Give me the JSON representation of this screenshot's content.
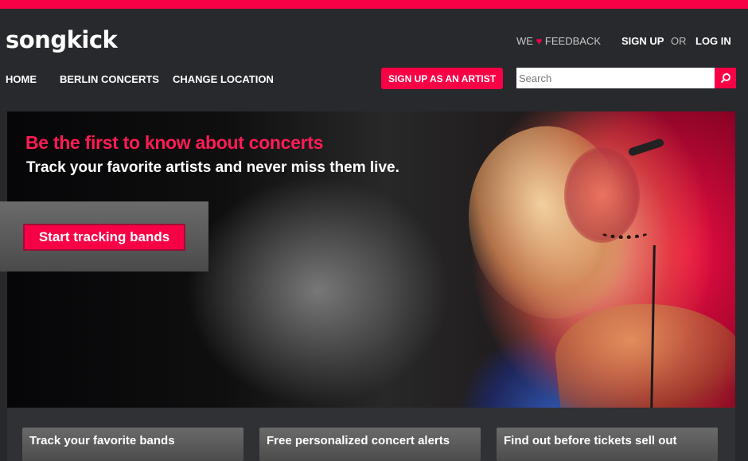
{
  "brand": {
    "logo_text": "songkick",
    "accent": "#f80046"
  },
  "utility": {
    "feedback_prefix": "WE",
    "heart_icon": "heart-icon",
    "feedback_suffix": "FEEDBACK",
    "signup": "SIGN UP",
    "or": "OR",
    "login": "LOG IN"
  },
  "nav": {
    "items": [
      {
        "label": "HOME"
      },
      {
        "label": "BERLIN CONCERTS"
      },
      {
        "label": "CHANGE LOCATION"
      }
    ],
    "artist_button": "SIGN UP AS AN ARTIST"
  },
  "search": {
    "placeholder": "Search",
    "icon": "search-icon"
  },
  "hero": {
    "headline": "Be the first to know about concerts",
    "subheadline": "Track your favorite artists and never miss them live.",
    "cta": "Start tracking bands"
  },
  "features": [
    {
      "label": "Track your favorite bands"
    },
    {
      "label": "Free personalized concert alerts"
    },
    {
      "label": "Find out before tickets sell out"
    }
  ]
}
